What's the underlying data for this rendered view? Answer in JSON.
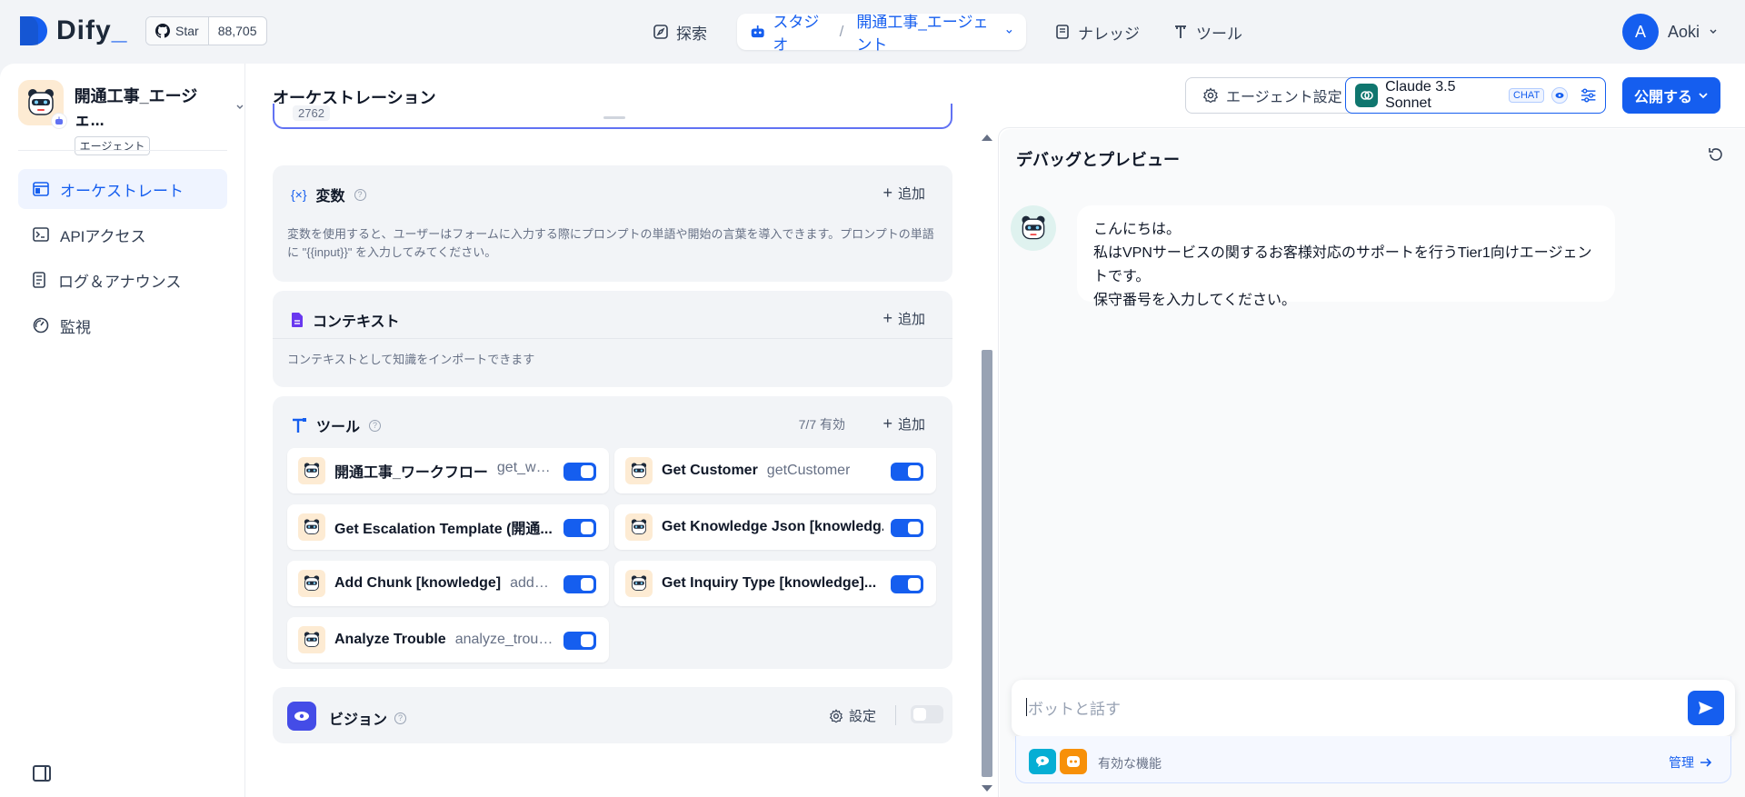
{
  "topbar": {
    "logo": "Dify",
    "github": {
      "star_label": "Star",
      "count": "88,705"
    },
    "nav": {
      "explore": "探索",
      "studio": "スタジオ",
      "breadcrumb_sep": "/",
      "app_name": "開通工事_エージェント",
      "knowledge": "ナレッジ",
      "tools": "ツール"
    },
    "user": {
      "initial": "A",
      "name": "Aoki"
    }
  },
  "sidebar": {
    "app_name": "開通工事_エージェ...",
    "app_type": "エージェント",
    "items": [
      {
        "label": "オーケストレート",
        "icon": "layout-icon"
      },
      {
        "label": "APIアクセス",
        "icon": "terminal-icon"
      },
      {
        "label": "ログ＆アナウンス",
        "icon": "file-list-icon"
      },
      {
        "label": "監視",
        "icon": "gauge-icon"
      }
    ]
  },
  "header": {
    "title": "オーケストレーション",
    "agent_settings": "エージェント設定",
    "model_name": "Claude 3.5 Sonnet",
    "model_mode": "CHAT",
    "publish": "公開する"
  },
  "prompt": {
    "char_count": "2762"
  },
  "variables": {
    "title": "変数",
    "add": "追加",
    "description": "変数を使用すると、ユーザーはフォームに入力する際にプロンプトの単語や開始の言葉を導入できます。プロンプトの単語に \"{{input}}\" を入力してみてください。"
  },
  "context": {
    "title": "コンテキスト",
    "add": "追加",
    "description": "コンテキストとして知識をインポートできます"
  },
  "tools": {
    "title": "ツール",
    "count": "7/7 有効",
    "add": "追加",
    "items": [
      {
        "name": "開通工事_ワークフロー",
        "id": "get_workfl...",
        "enabled": true
      },
      {
        "name": "Get Customer",
        "id": "getCustomer",
        "enabled": true
      },
      {
        "name": "Get Escalation Template (開通...",
        "id": "",
        "enabled": true
      },
      {
        "name": "Get Knowledge Json [knowledg...",
        "id": "",
        "enabled": true
      },
      {
        "name": "Add Chunk [knowledge]",
        "id": "add_c...",
        "enabled": true
      },
      {
        "name": "Get Inquiry Type [knowledge]...",
        "id": "",
        "enabled": true
      },
      {
        "name": "Analyze Trouble",
        "id": "analyze_trouble",
        "enabled": true
      }
    ]
  },
  "vision": {
    "title": "ビジョン",
    "settings": "設定",
    "enabled": false
  },
  "debug": {
    "title": "デバッグとプレビュー",
    "message_lines": [
      "こんにちは。",
      "私はVPNサービスの関するお客様対応のサポートを行うTier1向けエージェントです。",
      "保守番号を入力してください。"
    ],
    "input_placeholder": "ボットと話す",
    "features_label": "有効な機能",
    "manage": "管理"
  },
  "colors": {
    "accent": "#155eef",
    "background": "#f2f4f7",
    "card": "#f2f4f7"
  }
}
